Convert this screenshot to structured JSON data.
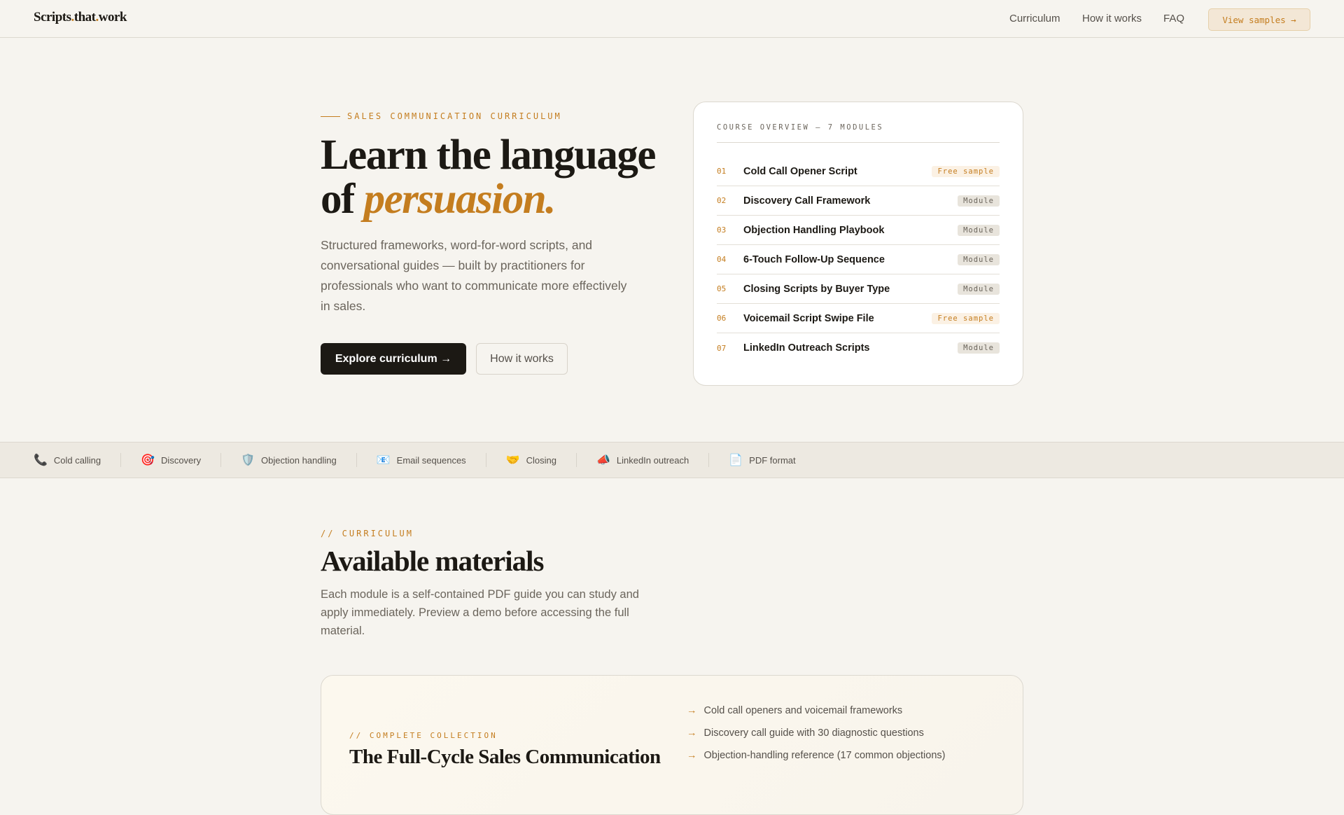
{
  "nav": {
    "logo": [
      "Scripts",
      ".",
      "that",
      ".",
      "work"
    ],
    "links": [
      "Curriculum",
      "How it works",
      "FAQ"
    ],
    "cta": "View samples →"
  },
  "hero": {
    "eyebrow": "SALES COMMUNICATION CURRICULUM",
    "title_line1": "Learn the language",
    "title_of": "of ",
    "title_accent": "persuasion.",
    "lead": "Structured frameworks, word-for-word scripts, and conversational guides — built by practitioners for professionals who want to communicate more effectively in sales.",
    "primary": "Explore curriculum →",
    "secondary": "How it works"
  },
  "card": {
    "header": "COURSE OVERVIEW — 7 MODULES",
    "modules": [
      {
        "num": "01",
        "title": "Cold Call Opener Script",
        "badge": "Free sample"
      },
      {
        "num": "02",
        "title": "Discovery Call Framework",
        "badge": "Module"
      },
      {
        "num": "03",
        "title": "Objection Handling Playbook",
        "badge": "Module"
      },
      {
        "num": "04",
        "title": "6-Touch Follow-Up Sequence",
        "badge": "Module"
      },
      {
        "num": "05",
        "title": "Closing Scripts by Buyer Type",
        "badge": "Module"
      },
      {
        "num": "06",
        "title": "Voicemail Script Swipe File",
        "badge": "Free sample"
      },
      {
        "num": "07",
        "title": "LinkedIn Outreach Scripts",
        "badge": "Module"
      }
    ]
  },
  "topics": [
    {
      "icon": "📞",
      "label": "Cold calling"
    },
    {
      "icon": "🎯",
      "label": "Discovery"
    },
    {
      "icon": "🛡️",
      "label": "Objection handling"
    },
    {
      "icon": "📧",
      "label": "Email sequences"
    },
    {
      "icon": "🤝",
      "label": "Closing"
    },
    {
      "icon": "📣",
      "label": "LinkedIn outreach"
    },
    {
      "icon": "📄",
      "label": "PDF format"
    }
  ],
  "curriculum": {
    "eyebrow": "// CURRICULUM",
    "title": "Available materials",
    "lead": "Each module is a self-contained PDF guide you can study and apply immediately. Preview a demo before accessing the full material."
  },
  "collection": {
    "eyebrow": "// COMPLETE COLLECTION",
    "title": "The Full-Cycle Sales Communication",
    "features": [
      "Cold call openers and voicemail frameworks",
      "Discovery call guide with 30 diagnostic questions",
      "Objection-handling reference (17 common objections)"
    ]
  }
}
